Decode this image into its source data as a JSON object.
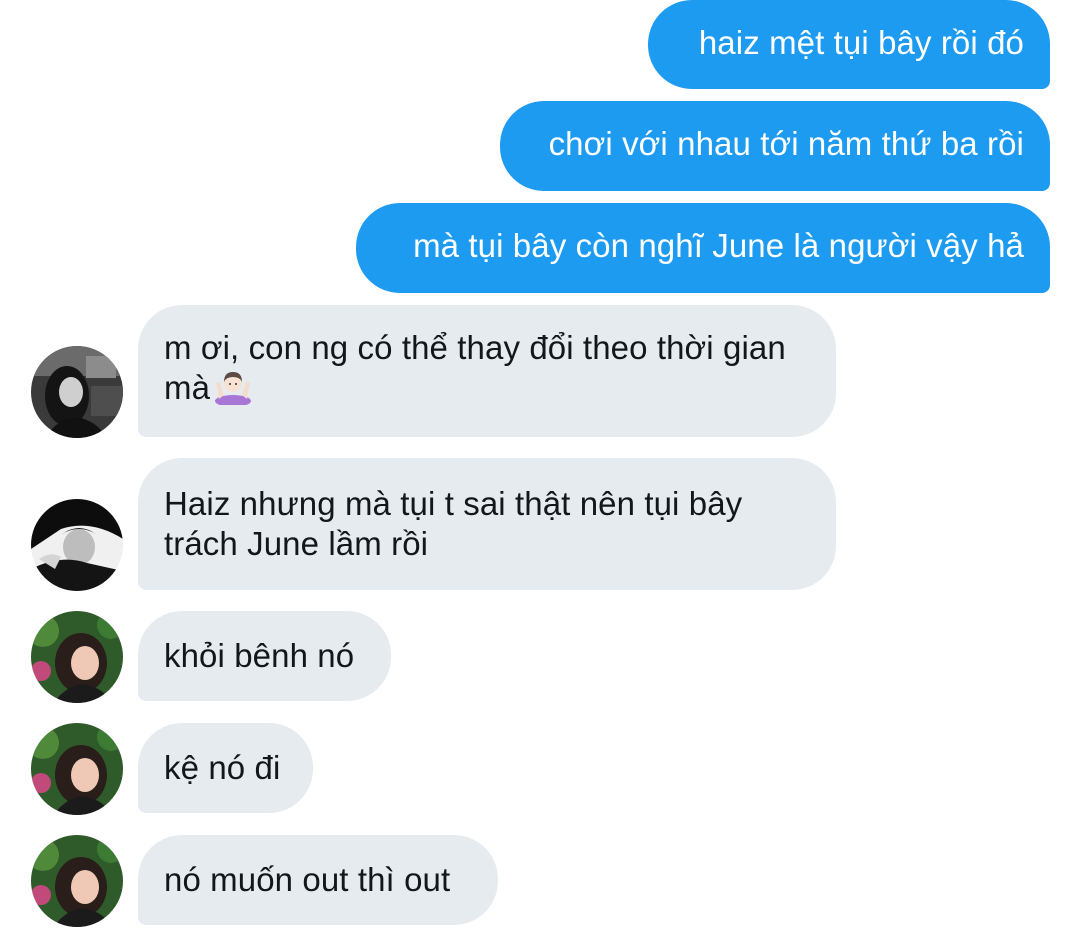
{
  "messages": {
    "out_1": "haiz mệt tụi bây rồi đó",
    "out_2": "chơi với nhau tới năm thứ ba rồi",
    "out_3": "mà tụi bây còn nghĩ June là người vậy hả",
    "in_1": "m ơi, con ng có thể thay đổi theo thời gian mà",
    "in_1_emoji": "person-shrugging-light-skin-emoji",
    "in_2": "Haiz nhưng mà tụi t sai thật nên tụi bây trách June lầm rồi",
    "in_3": "khỏi bênh nó",
    "in_4": "kệ nó đi",
    "in_5": "nó muốn out thì out"
  },
  "colors": {
    "outgoing_bubble": "#1d9bf0",
    "incoming_bubble": "#e6ebf0",
    "incoming_text": "#14171a",
    "outgoing_text": "#ffffff"
  },
  "avatars": [
    "avatar-grayscale-girl",
    "avatar-grayscale-boy",
    "avatar-color-girl",
    "avatar-color-girl",
    "avatar-color-girl"
  ]
}
